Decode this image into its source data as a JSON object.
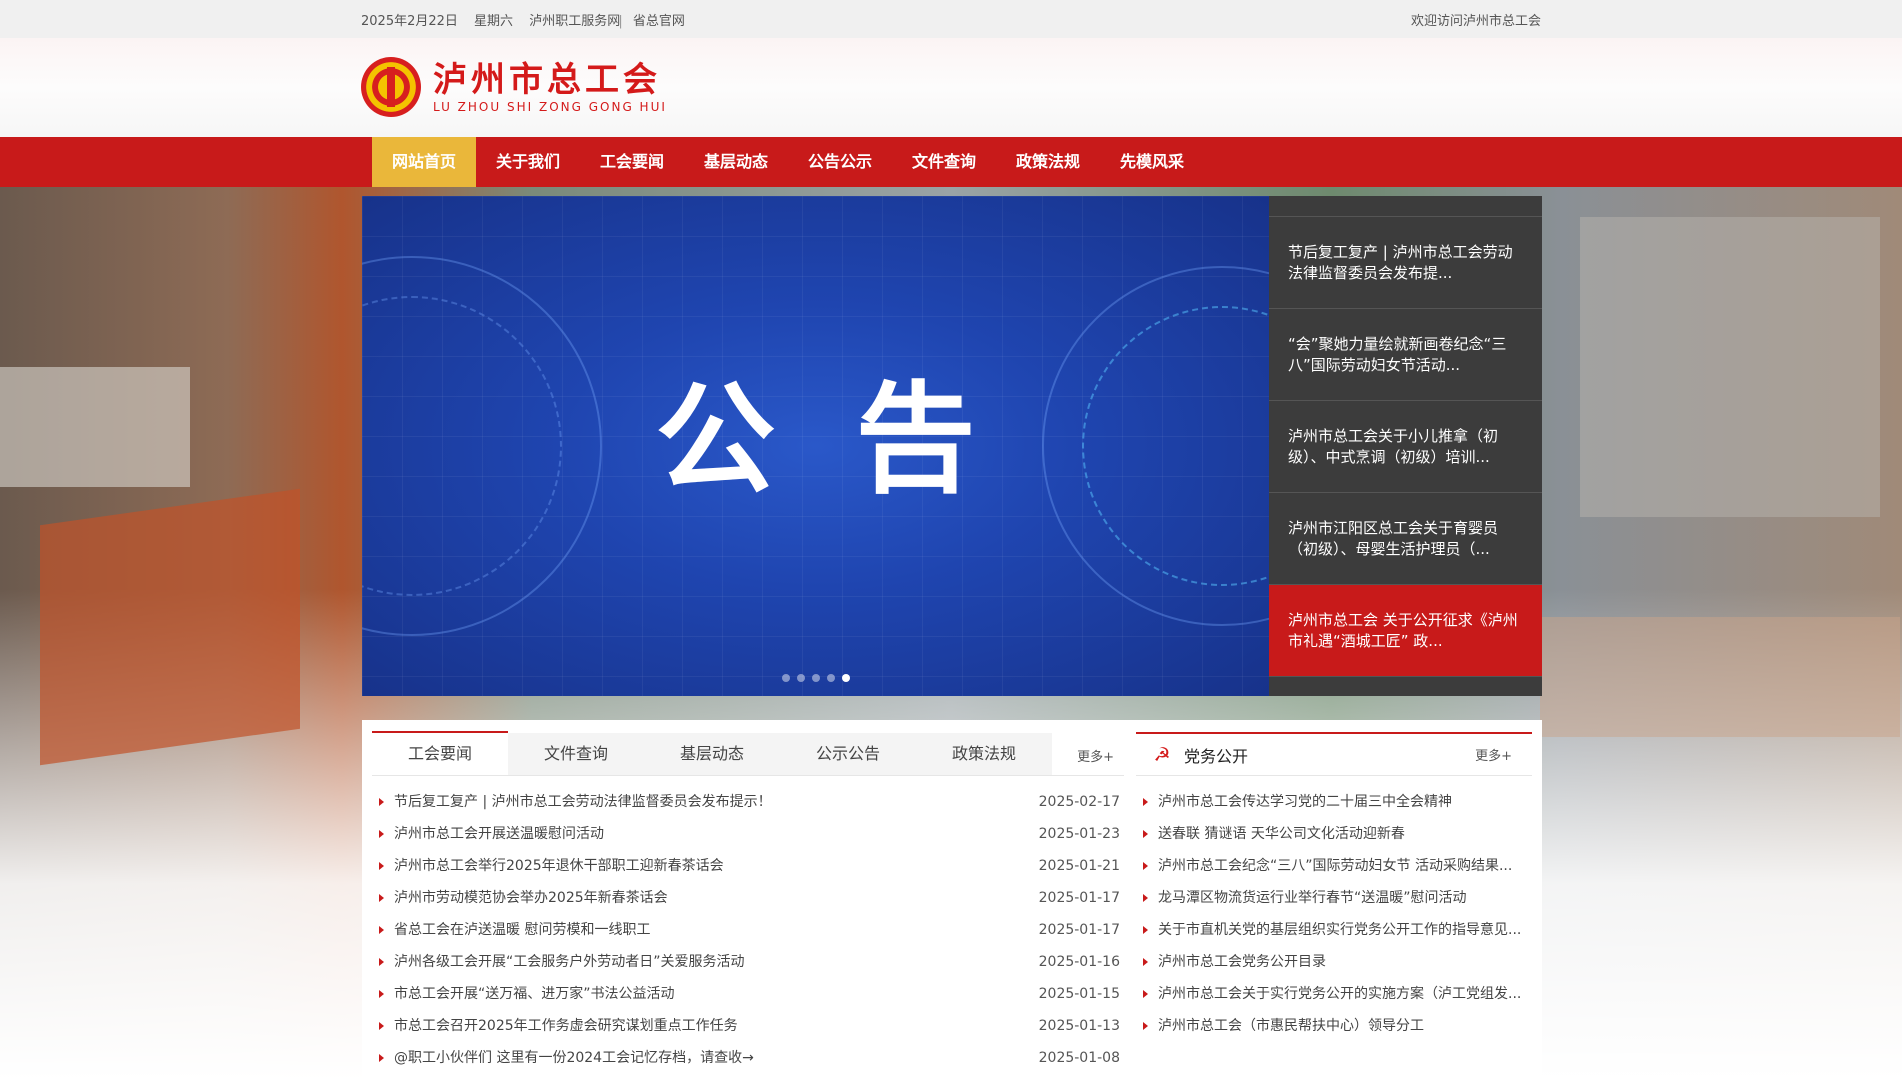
{
  "topbar": {
    "date": "2025年2月22日",
    "weekday": "星期六",
    "link1": "泸州职工服务网",
    "separator": "|",
    "link2": "省总官网",
    "welcome": "欢迎访问泸州市总工会"
  },
  "header": {
    "logo_cn": "泸州市总工会",
    "logo_en": "LU ZHOU SHI ZONG GONG HUI"
  },
  "nav": {
    "items": [
      "网站首页",
      "关于我们",
      "工会要闻",
      "基层动态",
      "公告公示",
      "文件查询",
      "政策法规",
      "先模风采"
    ]
  },
  "slider": {
    "title": "公告",
    "items": [
      "节后复工复产 | 泸州市总工会劳动法律监督委员会发布提...",
      "“会”聚她力量绘就新画卷纪念“三八”国际劳动妇女节活动...",
      "泸州市总工会关于小儿推拿（初级）、中式烹调（初级）培训...",
      "泸州市江阳区总工会关于育婴员（初级）、母婴生活护理员（...",
      "泸州市总工会 关于公开征求《泸州市礼遇“酒城工匠” 政..."
    ],
    "active_index": 4
  },
  "news": {
    "tabs": [
      "工会要闻",
      "文件查询",
      "基层动态",
      "公示公告",
      "政策法规"
    ],
    "more": "更多+",
    "rows": [
      {
        "title": "节后复工复产 | 泸州市总工会劳动法律监督委员会发布提示！",
        "date": "2025-02-17"
      },
      {
        "title": "泸州市总工会开展送温暖慰问活动",
        "date": "2025-01-23"
      },
      {
        "title": "泸州市总工会举行2025年退休干部职工迎新春茶话会",
        "date": "2025-01-21"
      },
      {
        "title": "泸州市劳动模范协会举办2025年新春茶话会",
        "date": "2025-01-17"
      },
      {
        "title": "省总工会在泸送温暖 慰问劳模和一线职工",
        "date": "2025-01-17"
      },
      {
        "title": "泸州各级工会开展“工会服务户外劳动者日”关爱服务活动",
        "date": "2025-01-16"
      },
      {
        "title": "市总工会开展“送万福、进万家”书法公益活动",
        "date": "2025-01-15"
      },
      {
        "title": "市总工会召开2025年工作务虚会研究谋划重点工作任务",
        "date": "2025-01-13"
      },
      {
        "title": "@职工小伙伴们 这里有一份2024工会记忆存档，请查收→",
        "date": "2025-01-08"
      }
    ]
  },
  "party": {
    "title": "党务公开",
    "more": "更多+",
    "rows": [
      "泸州市总工会传达学习党的二十届三中全会精神",
      "送春联 猜谜语 天华公司文化活动迎新春",
      "泸州市总工会纪念“三八”国际劳动妇女节 活动采购结果...",
      "龙马潭区物流货运行业举行春节“送温暖”慰问活动",
      "关于市直机关党的基层组织实行党务公开工作的指导意见...",
      "泸州市总工会党务公开目录",
      "泸州市总工会关于实行党务公开的实施方案（泸工党组发...",
      "泸州市总工会（市惠民帮扶中心）领导分工"
    ]
  },
  "colors": {
    "brand_red": "#c81a1a",
    "nav_active": "#eab73a",
    "slide_bg": "#1f45b0"
  }
}
